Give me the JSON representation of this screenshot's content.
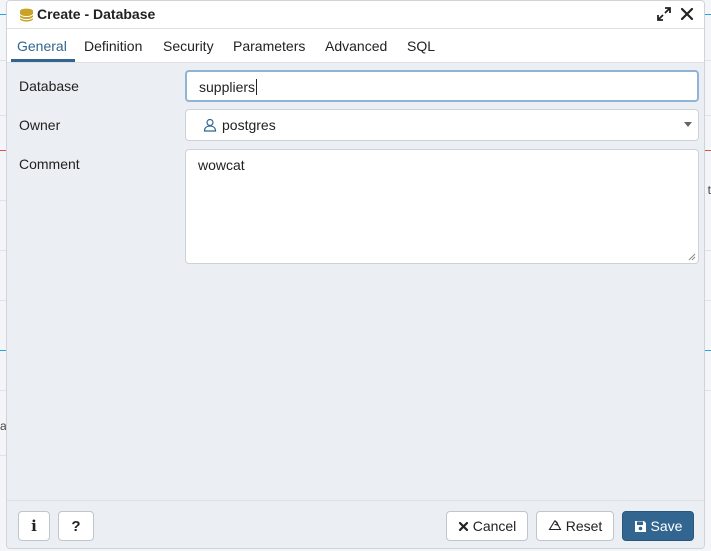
{
  "dialog": {
    "title": "Create - Database",
    "icons": {
      "title": "database-icon",
      "maximize": "expand-icon",
      "close": "close-icon"
    }
  },
  "tabs": [
    {
      "label": "General",
      "active": true
    },
    {
      "label": "Definition",
      "active": false
    },
    {
      "label": "Security",
      "active": false
    },
    {
      "label": "Parameters",
      "active": false
    },
    {
      "label": "Advanced",
      "active": false
    },
    {
      "label": "SQL",
      "active": false
    }
  ],
  "form": {
    "database": {
      "label": "Database",
      "value": "suppliers"
    },
    "owner": {
      "label": "Owner",
      "value": "postgres",
      "icon": "user-icon"
    },
    "comment": {
      "label": "Comment",
      "value": "wowcat"
    }
  },
  "footer": {
    "info_label": "i",
    "help_label": "?",
    "cancel_label": "Cancel",
    "reset_label": "Reset",
    "save_label": "Save"
  },
  "background": {
    "edge_char_right": "t",
    "edge_char_left": "a"
  },
  "colors": {
    "accent": "#326690",
    "focus_border": "#8fb4d6",
    "dialog_bg": "#ebeef3"
  }
}
